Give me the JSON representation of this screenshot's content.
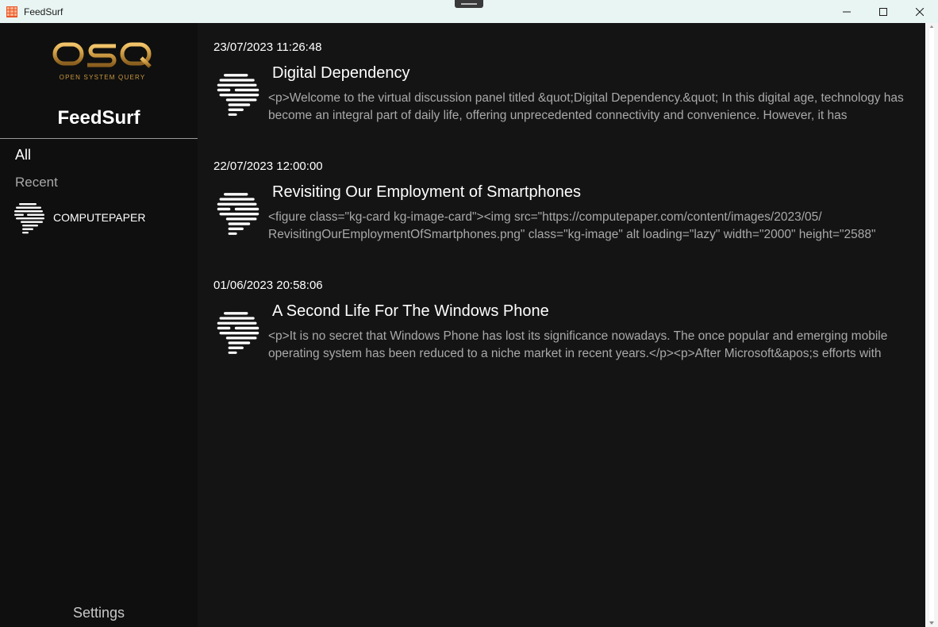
{
  "window": {
    "title": "FeedSurf",
    "controls": {
      "minimize": "minimize-icon",
      "maximize": "maximize-icon",
      "close": "close-icon"
    }
  },
  "sidebar": {
    "logo_text": "OSQ",
    "logo_subtitle": "OPEN SYSTEM QUERY",
    "brand": "FeedSurf",
    "nav": {
      "all": "All",
      "recent": "Recent"
    },
    "feeds": [
      {
        "name": "COMPUTEPAPER",
        "icon": "computepaper-logo-icon"
      }
    ],
    "settings": "Settings"
  },
  "articles": [
    {
      "date": "23/07/2023 11:26:48",
      "title": "Digital Dependency",
      "summary": "<p>Welcome to the virtual discussion panel titled &quot;Digital Dependency.&quot; In this digital age, technology has become an integral part of daily life, offering unprecedented connectivity and convenience. However, it has"
    },
    {
      "date": "22/07/2023 12:00:00",
      "title": "Revisiting Our Employment of Smartphones",
      "summary": "<figure class=\"kg-card kg-image-card\"><img src=\"https://computepaper.com/content/images/2023/05/ RevisitingOurEmploymentOfSmartphones.png\" class=\"kg-image\" alt loading=\"lazy\" width=\"2000\" height=\"2588\""
    },
    {
      "date": "01/06/2023 20:58:06",
      "title": "A Second Life For The Windows Phone",
      "summary": "<p>It is no secret that Windows Phone has lost its significance nowadays. The once popular and emerging mobile operating system has been reduced to a niche market in recent years.</p><p>After Microsoft&apos;s efforts with"
    }
  ],
  "colors": {
    "accent_gold": "#c9973f",
    "titlebar": "#e9f5f2",
    "sidebar_bg": "#0f0f0f",
    "main_bg": "#141414"
  }
}
